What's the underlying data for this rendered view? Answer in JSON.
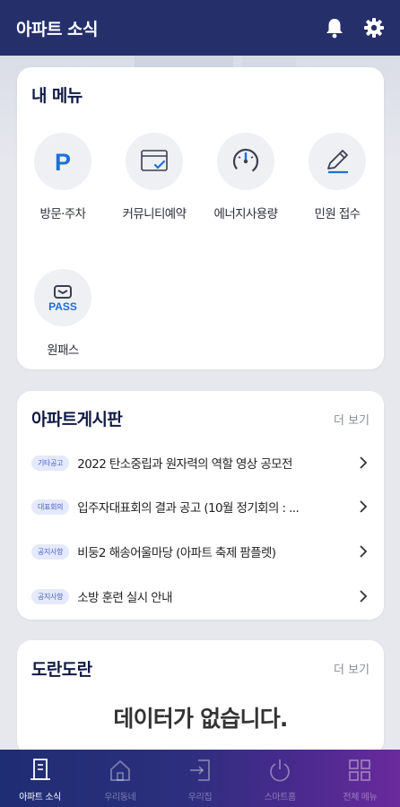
{
  "app": {
    "title": "아파트 소식"
  },
  "header_icons": [
    "bell-icon",
    "gear-icon"
  ],
  "my_menu": {
    "title": "내 메뉴",
    "items": [
      {
        "label": "방문·주차",
        "icon": "parking-icon"
      },
      {
        "label": "커뮤니티예약",
        "icon": "calendar-check-icon"
      },
      {
        "label": "에너지사용량",
        "icon": "gauge-icon"
      },
      {
        "label": "민원 접수",
        "icon": "pencil-icon"
      },
      {
        "label": "원패스",
        "icon": "pass-icon",
        "icon_text": "PASS"
      }
    ]
  },
  "board": {
    "title": "아파트게시판",
    "more": "더 보기",
    "posts": [
      {
        "tag": "기타공고",
        "title": "2022 탄소중립과 원자력의 역할 영상 공모전"
      },
      {
        "tag": "대표회의",
        "title": "입주자대표회의 결과 공고 (10월 정기회의 : ..."
      },
      {
        "tag": "공지사항",
        "title": "비둥2 해송어울마당 (아파트 축제 팜플렛)"
      },
      {
        "tag": "공지사항",
        "title": "소방 훈련 실시 안내"
      }
    ]
  },
  "doran": {
    "title": "도란도란",
    "more": "더 보기",
    "empty": "데이터가 없습니다."
  },
  "bottom_nav": [
    {
      "label": "아파트 소식",
      "icon": "apartment-icon",
      "active": true
    },
    {
      "label": "우리동네",
      "icon": "home-icon",
      "active": false
    },
    {
      "label": "우리집",
      "icon": "enter-door-icon",
      "active": false
    },
    {
      "label": "스마트홈",
      "icon": "power-icon",
      "active": false
    },
    {
      "label": "전체 메뉴",
      "icon": "grid-menu-icon",
      "active": false
    }
  ],
  "colors": {
    "header_bg": "#25306b",
    "accent_blue": "#1e6fd8",
    "tag_text": "#4a62c9",
    "tag_bg": "#e4e9fb"
  }
}
